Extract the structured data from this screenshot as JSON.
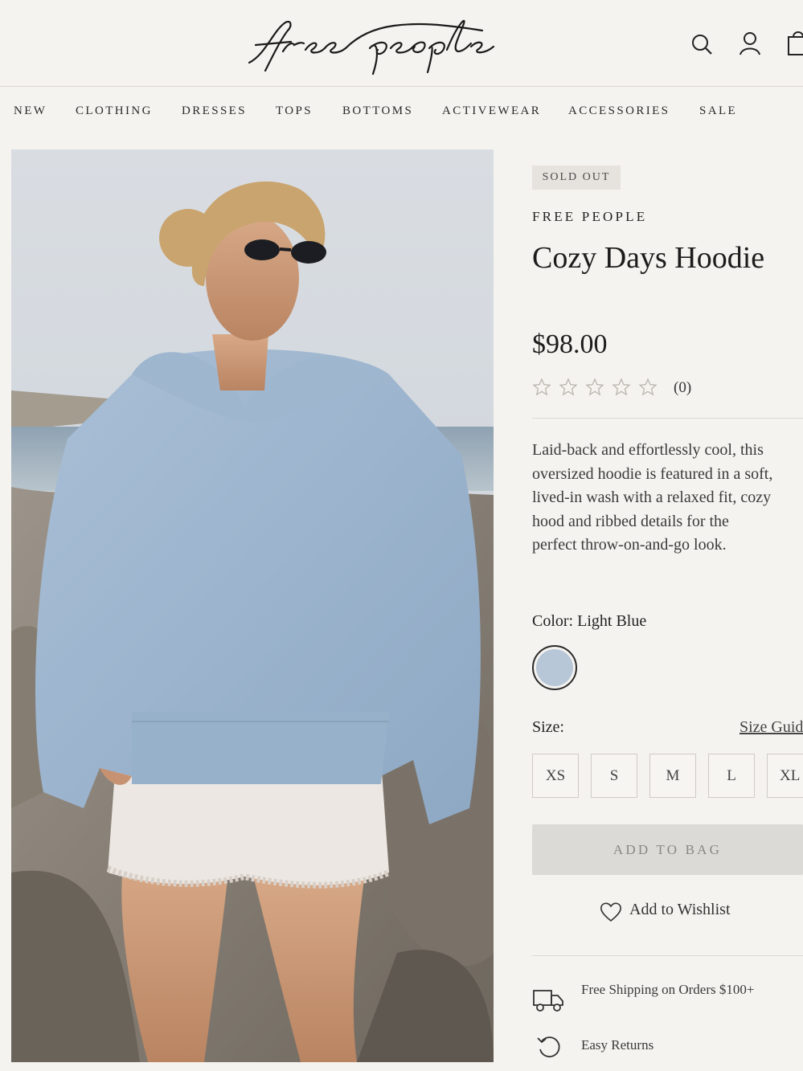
{
  "brand_logo_text": "free people",
  "header": {
    "icons": [
      "search-icon",
      "account-icon",
      "bag-icon"
    ]
  },
  "nav": {
    "items": [
      "NEW",
      "CLOTHING",
      "DRESSES",
      "TOPS",
      "BOTTOMS",
      "ACTIVEWEAR",
      "ACCESSORIES",
      "SALE"
    ]
  },
  "product": {
    "badge": "SOLD OUT",
    "brand": "FREE PEOPLE",
    "title": "Cozy Days Hoodie",
    "price": "$98.00",
    "rating": 0,
    "rating_count": "(0)",
    "description": "Laid-back and effortlessly cool, this oversized hoodie is featured in a soft, lived-in wash with a relaxed fit, cozy hood and ribbed details for the perfect throw-on-and-go look.",
    "color_label": "Color: Light Blue",
    "color_hex": "#b7c7d8",
    "size_label": "Size:",
    "size_guide": "Size Guide",
    "sizes": [
      "XS",
      "S",
      "M",
      "L",
      "XL"
    ],
    "add_to_bag": "ADD TO BAG",
    "wishlist": "Add to Wishlist",
    "perks": [
      {
        "icon": "truck-icon",
        "text": "Free Shipping on Orders $100+"
      },
      {
        "icon": "returns-icon",
        "text": "Easy Returns"
      }
    ]
  }
}
